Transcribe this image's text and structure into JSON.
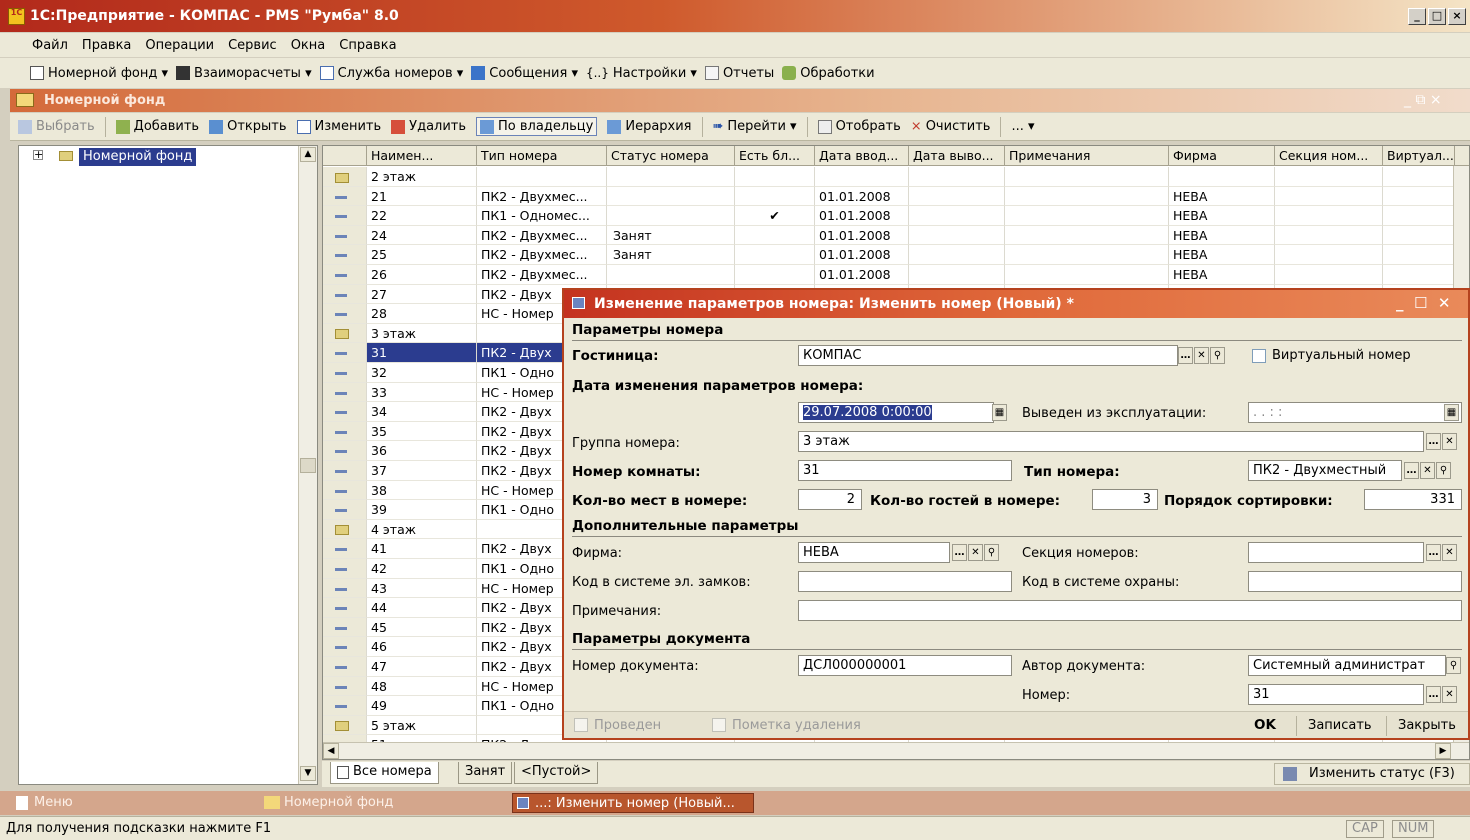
{
  "app": {
    "title": "1С:Предприятие - КОМПАС - PMS \"Румба\" 8.0",
    "logo_text": "1С"
  },
  "menu": [
    "Файл",
    "Правка",
    "Операции",
    "Сервис",
    "Окна",
    "Справка"
  ],
  "toolbar1": [
    "Номерной фонд ▾",
    "Взаиморасчеты ▾",
    "Служба номеров ▾",
    "Сообщения ▾",
    "Настройки ▾",
    "Отчеты",
    "Обработки"
  ],
  "child": {
    "title": "Номерной фонд"
  },
  "toolbar2": {
    "select": "Выбрать",
    "add": "Добавить",
    "open": "Открыть",
    "edit": "Изменить",
    "delete": "Удалить",
    "by_owner": "По владельцу",
    "hierarchy": "Иерархия",
    "goto": "Перейти ▾",
    "filter": "Отобрать",
    "clear": "Очистить",
    "more": "... ▾"
  },
  "tree": {
    "root": "Номерной фонд"
  },
  "grid": {
    "columns": [
      "Наимен...",
      "Тип номера",
      "Статус номера",
      "Есть бл...",
      "Дата ввод...",
      "Дата выво...",
      "Примечания",
      "Фирма",
      "Секция ном...",
      "Виртуал..."
    ],
    "rows": [
      {
        "kind": "folder",
        "name": "2 этаж",
        "type": "",
        "status": "",
        "flag": "",
        "date": "",
        "firm": ""
      },
      {
        "kind": "item",
        "name": "21",
        "type": "ПК2 - Двухмес...",
        "status": "",
        "flag": "",
        "date": "01.01.2008",
        "firm": "НЕВА"
      },
      {
        "kind": "item",
        "name": "22",
        "type": "ПК1 - Одномес...",
        "status": "",
        "flag": "✔",
        "date": "01.01.2008",
        "firm": "НЕВА"
      },
      {
        "kind": "item",
        "name": "24",
        "type": "ПК2 - Двухмес...",
        "status": "Занят",
        "flag": "",
        "date": "01.01.2008",
        "firm": "НЕВА"
      },
      {
        "kind": "item",
        "name": "25",
        "type": "ПК2 - Двухмес...",
        "status": "Занят",
        "flag": "",
        "date": "01.01.2008",
        "firm": "НЕВА"
      },
      {
        "kind": "item",
        "name": "26",
        "type": "ПК2 - Двухмес...",
        "status": "",
        "flag": "",
        "date": "01.01.2008",
        "firm": "НЕВА"
      },
      {
        "kind": "item",
        "name": "27",
        "type": "ПК2 - Двух",
        "status": "",
        "flag": "",
        "date": "",
        "firm": ""
      },
      {
        "kind": "item",
        "name": "28",
        "type": "НС - Номер",
        "status": "",
        "flag": "",
        "date": "",
        "firm": ""
      },
      {
        "kind": "folder",
        "name": "3 этаж",
        "type": "",
        "status": "",
        "flag": "",
        "date": "",
        "firm": ""
      },
      {
        "kind": "item",
        "name": "31",
        "type": "ПК2 - Двух",
        "status": "",
        "flag": "",
        "date": "",
        "firm": "",
        "selected": true
      },
      {
        "kind": "item",
        "name": "32",
        "type": "ПК1 - Одно",
        "status": "",
        "flag": "",
        "date": "",
        "firm": ""
      },
      {
        "kind": "item",
        "name": "33",
        "type": "НС - Номер",
        "status": "",
        "flag": "",
        "date": "",
        "firm": ""
      },
      {
        "kind": "item",
        "name": "34",
        "type": "ПК2 - Двух",
        "status": "",
        "flag": "",
        "date": "",
        "firm": ""
      },
      {
        "kind": "item",
        "name": "35",
        "type": "ПК2 - Двух",
        "status": "",
        "flag": "",
        "date": "",
        "firm": ""
      },
      {
        "kind": "item",
        "name": "36",
        "type": "ПК2 - Двух",
        "status": "",
        "flag": "",
        "date": "",
        "firm": ""
      },
      {
        "kind": "item",
        "name": "37",
        "type": "ПК2 - Двух",
        "status": "",
        "flag": "",
        "date": "",
        "firm": ""
      },
      {
        "kind": "item",
        "name": "38",
        "type": "НС - Номер",
        "status": "",
        "flag": "",
        "date": "",
        "firm": ""
      },
      {
        "kind": "item",
        "name": "39",
        "type": "ПК1 - Одно",
        "status": "",
        "flag": "",
        "date": "",
        "firm": ""
      },
      {
        "kind": "folder",
        "name": "4 этаж",
        "type": "",
        "status": "",
        "flag": "",
        "date": "",
        "firm": ""
      },
      {
        "kind": "item",
        "name": "41",
        "type": "ПК2 - Двух",
        "status": "",
        "flag": "",
        "date": "",
        "firm": ""
      },
      {
        "kind": "item",
        "name": "42",
        "type": "ПК1 - Одно",
        "status": "",
        "flag": "",
        "date": "",
        "firm": ""
      },
      {
        "kind": "item",
        "name": "43",
        "type": "НС - Номер",
        "status": "",
        "flag": "",
        "date": "",
        "firm": ""
      },
      {
        "kind": "item",
        "name": "44",
        "type": "ПК2 - Двух",
        "status": "",
        "flag": "",
        "date": "",
        "firm": ""
      },
      {
        "kind": "item",
        "name": "45",
        "type": "ПК2 - Двух",
        "status": "",
        "flag": "",
        "date": "",
        "firm": ""
      },
      {
        "kind": "item",
        "name": "46",
        "type": "ПК2 - Двух",
        "status": "",
        "flag": "",
        "date": "",
        "firm": ""
      },
      {
        "kind": "item",
        "name": "47",
        "type": "ПК2 - Двух",
        "status": "",
        "flag": "",
        "date": "",
        "firm": ""
      },
      {
        "kind": "item",
        "name": "48",
        "type": "НС - Номер",
        "status": "",
        "flag": "",
        "date": "",
        "firm": ""
      },
      {
        "kind": "item",
        "name": "49",
        "type": "ПК1 - Одно",
        "status": "",
        "flag": "",
        "date": "",
        "firm": ""
      },
      {
        "kind": "folder",
        "name": "5 этаж",
        "type": "",
        "status": "",
        "flag": "",
        "date": "",
        "firm": ""
      },
      {
        "kind": "item",
        "name": "51",
        "type": "ПК2 - Двух",
        "status": "",
        "flag": "",
        "date": "",
        "firm": ""
      }
    ]
  },
  "tabs": [
    "Все номера",
    "Занят",
    "<Пустой>"
  ],
  "change_status": "Изменить статус (F3)",
  "taskbar": [
    "Меню",
    "Номерной фонд",
    "...: Изменить номер (Новый..."
  ],
  "status": {
    "hint": "Для получения подсказки нажмите F1",
    "cap": "CAP",
    "num": "NUM"
  },
  "dialog": {
    "title": "Изменение параметров номера: Изменить номер (Новый) *",
    "sec_params": "Параметры номера",
    "hotel_label": "Гостиница:",
    "hotel_value": "КОМПАС",
    "virtual_label": "Виртуальный номер",
    "date_change_label": "Дата изменения параметров номера:",
    "date_value": "29.07.2008 0:00:00",
    "retired_label": "Выведен из эксплуатации:",
    "retired_value": ". .     : :",
    "group_label": "Группа номера:",
    "group_value": "3 этаж",
    "room_label": "Номер комнаты:",
    "room_value": "31",
    "roomtype_label": "Тип номера:",
    "roomtype_value": "ПК2 - Двухместный",
    "places_label": "Кол-во мест в номере:",
    "places_value": "2",
    "guests_label": "Кол-во гостей в номере:",
    "guests_value": "3",
    "sort_label": "Порядок сортировки:",
    "sort_value": "331",
    "sec_extra": "Дополнительные параметры",
    "firm_label": "Фирма:",
    "firm_value": "НЕВА",
    "section_label": "Секция номеров:",
    "section_value": "",
    "lock_label": "Код в системе эл. замков:",
    "lock_value": "",
    "guard_label": "Код в системе охраны:",
    "guard_value": "",
    "notes_label": "Примечания:",
    "notes_value": "",
    "sec_doc": "Параметры документа",
    "docnum_label": "Номер документа:",
    "docnum_value": "ДСЛ000000001",
    "author_label": "Автор документа:",
    "author_value": "Системный администрат",
    "number_label": "Номер:",
    "number_value": "31",
    "posted_label": "Проведен",
    "delmark_label": "Пометка удаления",
    "ok": "OK",
    "save": "Записать",
    "close": "Закрыть"
  }
}
